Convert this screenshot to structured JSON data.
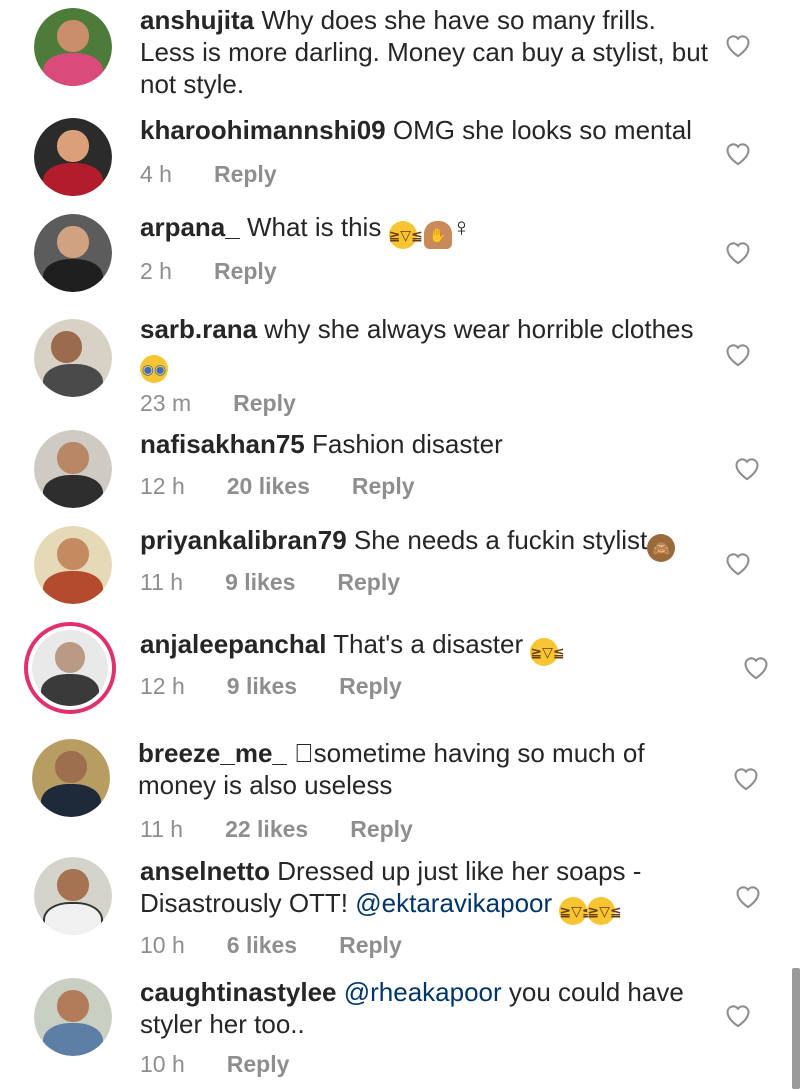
{
  "comments": [
    {
      "username": "anshujita",
      "text": " Why does she have so many frills. Less is more darling. Money can buy a stylist, but not style.",
      "time": "",
      "likes": "",
      "reply": ""
    },
    {
      "username": "kharoohimannshi09",
      "text": " OMG she looks so mental",
      "time": "4 h",
      "likes": "",
      "reply": "Reply"
    },
    {
      "username": "arpana_",
      "text": " What is this ",
      "emoji_after": "♀",
      "time": "2 h",
      "likes": "",
      "reply": "Reply"
    },
    {
      "username": "sarb.rana",
      "text": " why she always wear horrible clothes ",
      "time": "23 m",
      "likes": "",
      "reply": "Reply"
    },
    {
      "username": "nafisakhan75",
      "text": " Fashion disaster",
      "time": "12 h",
      "likes": "20 likes",
      "reply": "Reply"
    },
    {
      "username": "priyankalibran79",
      "text": " She needs a fuckin stylist",
      "time": "11 h",
      "likes": "9 likes",
      "reply": "Reply"
    },
    {
      "username": "anjaleepanchal",
      "text": " That's a disaster ",
      "time": "12 h",
      "likes": "9 likes",
      "reply": "Reply"
    },
    {
      "username": "breeze_me_",
      "text": " \u0000sometime having so much of money is also useless",
      "time": "11 h",
      "likes": "22 likes",
      "reply": "Reply"
    },
    {
      "username": "anselnetto",
      "text": " Dressed up just like her soaps - Disastrously OTT! ",
      "mention": "@ektaravikapoor",
      "time": "10 h",
      "likes": "6 likes",
      "reply": "Reply"
    },
    {
      "username": "caughtinastylee",
      "text_before": " ",
      "mention": "@rheakapoor",
      "text": " you could have styler her too..",
      "time": "10 h",
      "likes": "",
      "reply": "Reply"
    }
  ],
  "icons": {
    "heart": "heart-outline-icon",
    "laugh": "grinning-squinting-face-emoji",
    "shock": "fearful-face-emoji",
    "facepalm": "woman-facepalming-emoji",
    "monkey": "see-no-evil-monkey-emoji"
  },
  "colors": {
    "text": "#262626",
    "meta": "#8e8e8e",
    "mention": "#003569",
    "story_ring": "#e1306c"
  }
}
